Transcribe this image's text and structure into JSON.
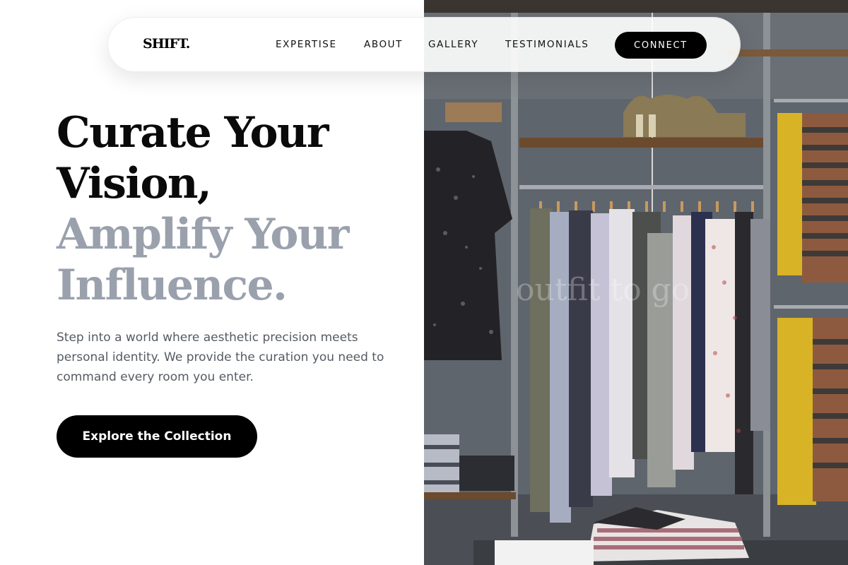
{
  "brand": {
    "logo_text": "SHIFT."
  },
  "nav": {
    "links": [
      "EXPERTISE",
      "ABOUT",
      "GALLERY",
      "TESTIMONIALS"
    ],
    "connect_label": "CONNECT"
  },
  "hero": {
    "headline_dark": [
      "Curate Your",
      "Vision,"
    ],
    "headline_grey": [
      "Amplify Your",
      "Influence."
    ],
    "subcopy": "Step into a world where aesthetic precision meets personal identity. We provide the curation you need to command every room you enter.",
    "cta_label": "Explore the Collection"
  },
  "photo": {
    "subject": "boutique-clothing-rack-photo",
    "watermark": "outfit to go"
  },
  "colors": {
    "accent": "#000000",
    "headline_dark": "#0a0a0a",
    "headline_grey": "#9aa1ad",
    "body_text": "#555b63",
    "background": "#ffffff"
  }
}
